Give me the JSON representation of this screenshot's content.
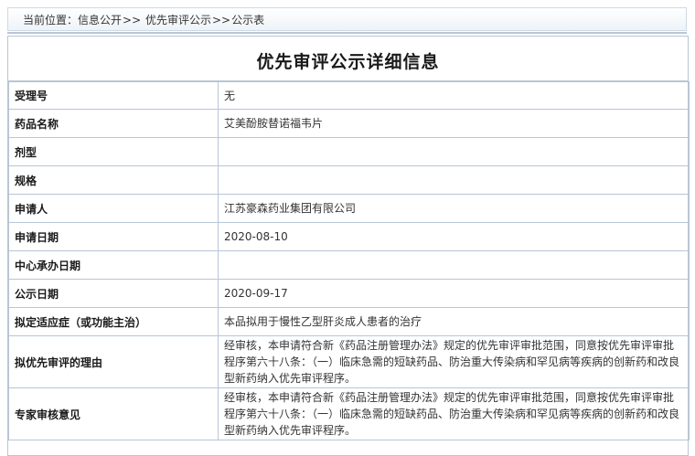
{
  "breadcrumb": {
    "prefix": "当前位置：",
    "items": [
      "信息公开",
      "优先审评公示",
      "公示表"
    ],
    "separator": ">>"
  },
  "page_title": "优先审评公示详细信息",
  "fields": [
    {
      "label": "受理号",
      "value": "无"
    },
    {
      "label": "药品名称",
      "value": "艾美酚胺替诺福韦片"
    },
    {
      "label": "剂型",
      "value": ""
    },
    {
      "label": "规格",
      "value": ""
    },
    {
      "label": "申请人",
      "value": "江苏豪森药业集团有限公司"
    },
    {
      "label": "申请日期",
      "value": "2020-08-10"
    },
    {
      "label": "中心承办日期",
      "value": ""
    },
    {
      "label": "公示日期",
      "value": "2020-09-17"
    },
    {
      "label": "拟定适应症（或功能主治）",
      "value": "本品拟用于慢性乙型肝炎成人患者的治疗"
    },
    {
      "label": "拟优先审评的理由",
      "value": "经审核，本申请符合新《药品注册管理办法》规定的优先审评审批范围，同意按优先审评审批程序第六十八条：（一）临床急需的短缺药品、防治重大传染病和罕见病等疾病的创新药和改良型新药纳入优先审评程序。"
    },
    {
      "label": "专家审核意见",
      "value": "经审核，本申请符合新《药品注册管理办法》规定的优先审评审批范围，同意按优先审评审批程序第六十八条：（一）临床急需的短缺药品、防治重大传染病和罕见病等疾病的创新药和改良型新药纳入优先审评程序。"
    }
  ]
}
